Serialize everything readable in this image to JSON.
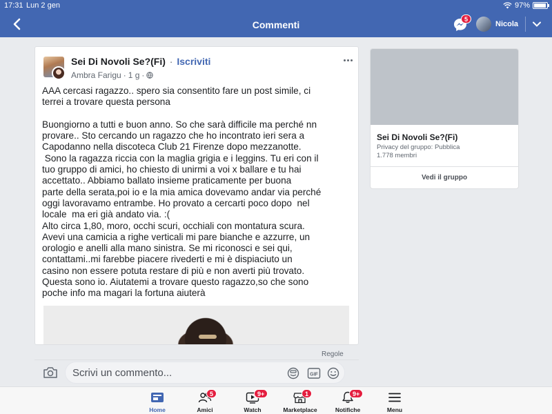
{
  "status_bar": {
    "time": "17:31",
    "date": "Lun 2 gen",
    "battery": "97%",
    "battery_level": 0.97
  },
  "header": {
    "title": "Commenti",
    "messenger_badge": "5",
    "user_name": "Nicola"
  },
  "post": {
    "group_name": "Sei Di Novoli Se?(Fi)",
    "separator": "·",
    "subscribe_label": "Iscriviti",
    "author": "Ambra Farigu",
    "time": "1 g",
    "text": "AAA cercasi ragazzo.. spero sia consentito fare un post simile, ci\nterrei a trovare questa persona\n\nBuongiorno a tutti e buon anno. So che sarà difficile ma perché nn\nprovare.. Sto cercando un ragazzo che ho incontrato ieri sera a\nCapodanno nella discoteca Club 21 Firenze dopo mezzanotte.\n Sono la ragazza riccia con la maglia grigia e i leggins. Tu eri con il\ntuo gruppo di amici, ho chiesto di unirmi a voi x ballare e tu hai\naccettato.. Abbiamo ballato insieme praticamente per buona\nparte della serata,poi io e la mia amica dovevamo andar via perché\noggi lavoravamo entrambe. Ho provato a cercarti poco dopo  nel\nlocale  ma eri già andato via. :(\nAlto circa 1,80, moro, occhi scuri, occhiali con montatura scura.\nAvevi una camicia a righe verticali mi pare bianche e azzurre, un\norologio e anelli alla mano sinistra. Se mi riconosci e sei qui,\ncontattami..mi farebbe piacere rivederti e mi è dispiaciuto un\ncasino non essere potuta restare di più e non averti più trovato.\nQuesta sono io. Aiutatemi a trovare questo ragazzo,so che sono\npoche info ma magari la fortuna aiuterà"
  },
  "group_card": {
    "name": "Sei Di Novoli Se?(Fi)",
    "privacy": "Privacy del gruppo: Pubblica",
    "members": "1.778 membri",
    "button": "Vedi il gruppo"
  },
  "comments": {
    "rules_label": "Regole",
    "placeholder": "Scrivi un commento..."
  },
  "tabbar": {
    "items": [
      {
        "label": "Home",
        "icon": "home-icon",
        "badge": ""
      },
      {
        "label": "Amici",
        "icon": "friends-icon",
        "badge": "5"
      },
      {
        "label": "Watch",
        "icon": "watch-icon",
        "badge": "9+"
      },
      {
        "label": "Marketplace",
        "icon": "marketplace-icon",
        "badge": "1"
      },
      {
        "label": "Notifiche",
        "icon": "bell-icon",
        "badge": "9+"
      },
      {
        "label": "Menu",
        "icon": "menu-icon",
        "badge": ""
      }
    ],
    "active": "Home"
  },
  "colors": {
    "brand_blue": "#4267b2",
    "badge_red": "#e41e3f",
    "page_bg": "#e9ebee"
  }
}
